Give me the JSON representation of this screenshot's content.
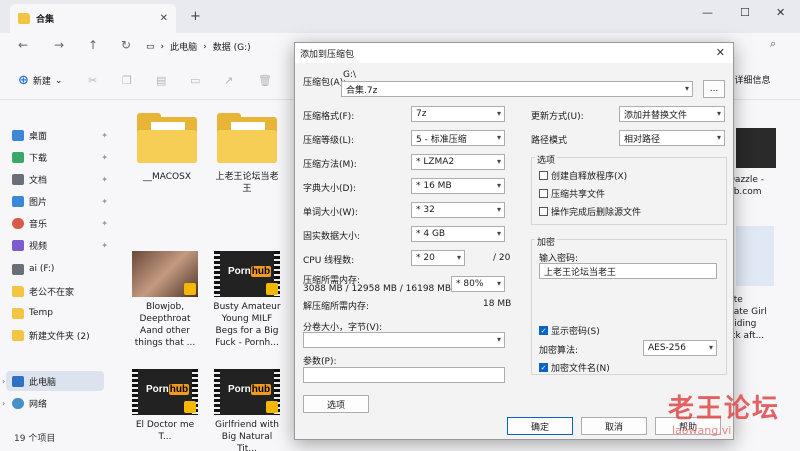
{
  "explorer": {
    "tab_title": "合集",
    "breadcrumb": [
      "此电脑",
      "数据 (G:)"
    ],
    "toolbar": {
      "new_label": "新建",
      "details_label": "详细信息"
    },
    "status": "19 个项目",
    "sidebar": {
      "quick": [
        {
          "label": "桌面",
          "icon": "desktop-icon"
        },
        {
          "label": "下载",
          "icon": "download-icon"
        },
        {
          "label": "文档",
          "icon": "document-icon"
        },
        {
          "label": "图片",
          "icon": "picture-icon"
        },
        {
          "label": "音乐",
          "icon": "music-icon"
        },
        {
          "label": "视频",
          "icon": "video-icon"
        }
      ],
      "drives": [
        {
          "label": "ai (F:)"
        },
        {
          "label": "老公不在家"
        },
        {
          "label": "Temp"
        },
        {
          "label": "新建文件夹 (2)"
        }
      ],
      "this_pc": "此电脑",
      "network": "网络"
    },
    "files": [
      {
        "name": "__MACOSX",
        "kind": "folder"
      },
      {
        "name": "上老王论坛当老王",
        "kind": "folder"
      },
      {
        "name": "Blowjob, Deepthroat Aand other things that ...",
        "kind": "video"
      },
      {
        "name": "Busty Amateur Young MILF Begs for a Big Fuck - Pornh...",
        "kind": "pornhub"
      },
      {
        "name": "El Doctor me T...",
        "kind": "pornhub"
      },
      {
        "name": "Girlfriend with Big Natural Tit...",
        "kind": "pornhub"
      }
    ],
    "partial_right": [
      "Dazzle -",
      "ub.com",
      "ute",
      "nate Girl",
      "Riding",
      "ick aft..."
    ]
  },
  "dialog": {
    "title": "添加到压缩包",
    "archive_label": "压缩包(A):",
    "archive_dir": "G:\\",
    "archive_name": "合集.7z",
    "browse_label": "...",
    "format_label": "压缩格式(F):",
    "format_value": "7z",
    "level_label": "压缩等级(L):",
    "level_value": "5 - 标准压缩",
    "method_label": "压缩方法(M):",
    "method_value": "* LZMA2",
    "dict_label": "字典大小(D):",
    "dict_value": "* 16 MB",
    "word_label": "单词大小(W):",
    "word_value": "* 32",
    "solid_label": "固实数据大小:",
    "solid_value": "* 4 GB",
    "threads_label": "CPU 线程数:",
    "threads_value": "* 20",
    "threads_total": "/ 20",
    "mem_label": "压缩所需内存:",
    "mem_value": "3088 MB / 12958 MB / 16198 MB",
    "mem_percent": "* 80%",
    "decomp_label": "解压缩所需内存:",
    "decomp_value": "18 MB",
    "split_label": "分卷大小，字节(V):",
    "params_label": "参数(P):",
    "options_button": "选项",
    "update_label": "更新方式(U):",
    "update_value": "添加并替换文件",
    "pathmode_label": "路径模式",
    "pathmode_value": "相对路径",
    "opts_title": "选项",
    "opt_sfx": "创建自释放程序(X)",
    "opt_shared": "压缩共享文件",
    "opt_delete": "操作完成后删除源文件",
    "enc_title": "加密",
    "pwd_label": "输入密码:",
    "pwd_value": "上老王论坛当老王",
    "show_pwd": "显示密码(S)",
    "enc_method_label": "加密算法:",
    "enc_method_value": "AES-256",
    "enc_names": "加密文件名(N)",
    "ok": "确定",
    "cancel": "取消",
    "help": "帮助"
  },
  "watermark": {
    "text": "老王论坛",
    "sub": "laowang.vi"
  }
}
